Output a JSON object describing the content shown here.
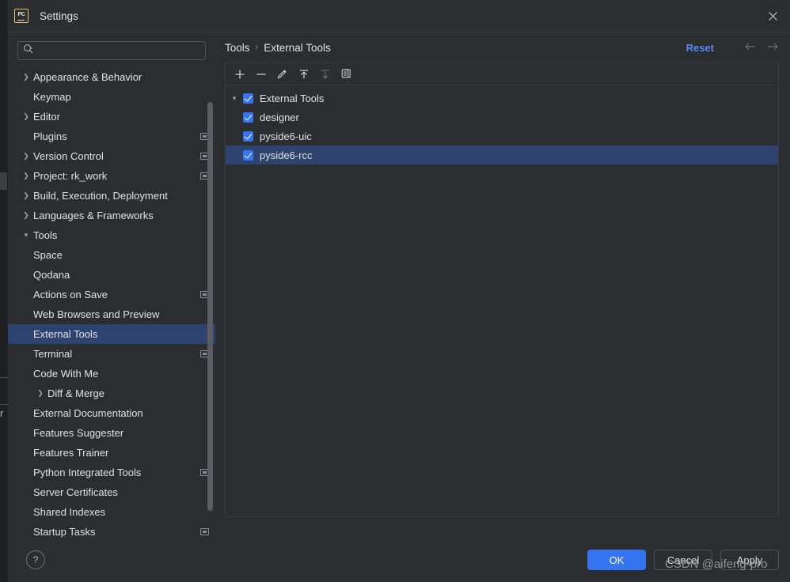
{
  "window": {
    "title": "Settings",
    "app_icon": "pycharm-icon",
    "app_icon_text": "PC",
    "close_icon": "close-icon"
  },
  "search": {
    "value": "",
    "placeholder": "",
    "icon": "search-icon"
  },
  "sidebar": {
    "items": [
      {
        "label": "Appearance & Behavior",
        "indent": 0,
        "expandable": true,
        "expanded": false,
        "badge": false,
        "selected": false
      },
      {
        "label": "Keymap",
        "indent": 0,
        "expandable": false,
        "expanded": false,
        "badge": false,
        "selected": false
      },
      {
        "label": "Editor",
        "indent": 0,
        "expandable": true,
        "expanded": false,
        "badge": false,
        "selected": false
      },
      {
        "label": "Plugins",
        "indent": 0,
        "expandable": false,
        "expanded": false,
        "badge": true,
        "selected": false
      },
      {
        "label": "Version Control",
        "indent": 0,
        "expandable": true,
        "expanded": false,
        "badge": true,
        "selected": false
      },
      {
        "label": "Project: rk_work",
        "indent": 0,
        "expandable": true,
        "expanded": false,
        "badge": true,
        "selected": false
      },
      {
        "label": "Build, Execution, Deployment",
        "indent": 0,
        "expandable": true,
        "expanded": false,
        "badge": false,
        "selected": false
      },
      {
        "label": "Languages & Frameworks",
        "indent": 0,
        "expandable": true,
        "expanded": false,
        "badge": false,
        "selected": false
      },
      {
        "label": "Tools",
        "indent": 0,
        "expandable": true,
        "expanded": true,
        "badge": false,
        "selected": false
      },
      {
        "label": "Space",
        "indent": 1,
        "expandable": false,
        "expanded": false,
        "badge": false,
        "selected": false
      },
      {
        "label": "Qodana",
        "indent": 1,
        "expandable": false,
        "expanded": false,
        "badge": false,
        "selected": false
      },
      {
        "label": "Actions on Save",
        "indent": 1,
        "expandable": false,
        "expanded": false,
        "badge": true,
        "selected": false
      },
      {
        "label": "Web Browsers and Preview",
        "indent": 1,
        "expandable": false,
        "expanded": false,
        "badge": false,
        "selected": false
      },
      {
        "label": "External Tools",
        "indent": 1,
        "expandable": false,
        "expanded": false,
        "badge": false,
        "selected": true
      },
      {
        "label": "Terminal",
        "indent": 1,
        "expandable": false,
        "expanded": false,
        "badge": true,
        "selected": false
      },
      {
        "label": "Code With Me",
        "indent": 1,
        "expandable": false,
        "expanded": false,
        "badge": false,
        "selected": false
      },
      {
        "label": "Diff & Merge",
        "indent": 1,
        "expandable": true,
        "expanded": false,
        "badge": false,
        "selected": false
      },
      {
        "label": "External Documentation",
        "indent": 1,
        "expandable": false,
        "expanded": false,
        "badge": false,
        "selected": false
      },
      {
        "label": "Features Suggester",
        "indent": 1,
        "expandable": false,
        "expanded": false,
        "badge": false,
        "selected": false
      },
      {
        "label": "Features Trainer",
        "indent": 1,
        "expandable": false,
        "expanded": false,
        "badge": false,
        "selected": false
      },
      {
        "label": "Python Integrated Tools",
        "indent": 1,
        "expandable": false,
        "expanded": false,
        "badge": true,
        "selected": false
      },
      {
        "label": "Server Certificates",
        "indent": 1,
        "expandable": false,
        "expanded": false,
        "badge": false,
        "selected": false
      },
      {
        "label": "Shared Indexes",
        "indent": 1,
        "expandable": false,
        "expanded": false,
        "badge": false,
        "selected": false
      },
      {
        "label": "Startup Tasks",
        "indent": 1,
        "expandable": false,
        "expanded": false,
        "badge": true,
        "selected": false
      }
    ]
  },
  "header": {
    "breadcrumb": [
      "Tools",
      "External Tools"
    ],
    "separator": "›",
    "reset_label": "Reset",
    "back_icon": "arrow-left-icon",
    "forward_icon": "arrow-right-icon"
  },
  "toolbar": {
    "buttons": [
      {
        "name": "add-tool-button",
        "icon": "plus-icon",
        "enabled": true
      },
      {
        "name": "remove-tool-button",
        "icon": "minus-icon",
        "enabled": true
      },
      {
        "name": "edit-tool-button",
        "icon": "pencil-icon",
        "enabled": true
      },
      {
        "name": "move-up-button",
        "icon": "arrow-up-icon",
        "enabled": true
      },
      {
        "name": "move-down-button",
        "icon": "arrow-down-icon",
        "enabled": false
      },
      {
        "name": "copy-tool-button",
        "icon": "copy-icon",
        "enabled": true
      }
    ]
  },
  "tools_tree": {
    "root": {
      "label": "External Tools",
      "checked": true,
      "expanded": true,
      "selected": false
    },
    "children": [
      {
        "label": "designer",
        "checked": true,
        "selected": false
      },
      {
        "label": "pyside6-uic",
        "checked": true,
        "selected": false
      },
      {
        "label": "pyside6-rcc",
        "checked": true,
        "selected": true
      }
    ]
  },
  "footer": {
    "help_icon": "help-icon",
    "help_label": "?",
    "ok_label": "OK",
    "cancel_label": "Cancel",
    "apply_label": "Apply"
  },
  "watermark": {
    "text": "CSDN @aifeng-pro"
  },
  "background_artifact": {
    "glyph": "r"
  },
  "colors": {
    "dialog_bg": "#2b2d30",
    "selection_blue": "#2e436e",
    "accent_blue": "#3574f0",
    "link_blue": "#548af7",
    "text": "#dfe1e5",
    "border": "#393b40",
    "icon_border_yellow": "#f2c55c"
  }
}
